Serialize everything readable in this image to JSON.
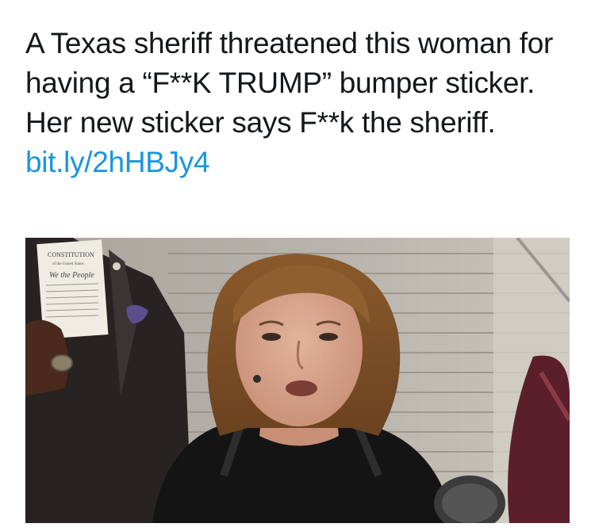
{
  "tweet": {
    "text": "A Texas sheriff threatened this woman for having a “F**K TRUMP” bumper sticker. Her new sticker says F**k the sheriff.",
    "link_text": "bit.ly/2hHBJy4"
  },
  "media": {
    "document_heading": "CONSTITUTION",
    "document_subheading": "of the United States",
    "document_script": "We the People"
  },
  "colors": {
    "text": "#14171a",
    "link": "#1b95e0"
  }
}
